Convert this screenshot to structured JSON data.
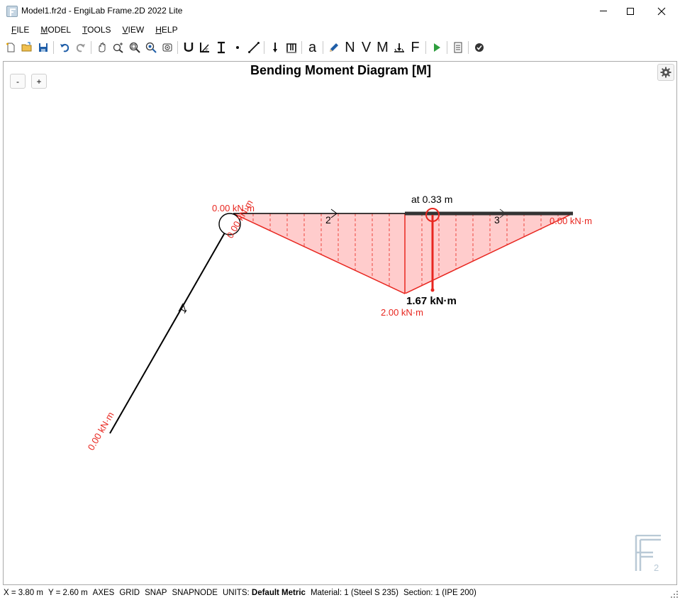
{
  "window": {
    "title": "Model1.fr2d - EngiLab Frame.2D 2022 Lite",
    "controls": [
      "minimize",
      "maximize",
      "close"
    ]
  },
  "menu": [
    {
      "label": "FILE",
      "mnemonic": "F",
      "rest": "ILE"
    },
    {
      "label": "MODEL",
      "mnemonic": "M",
      "rest": "ODEL"
    },
    {
      "label": "TOOLS",
      "mnemonic": "T",
      "rest": "OOLS"
    },
    {
      "label": "VIEW",
      "mnemonic": "V",
      "rest": "IEW"
    },
    {
      "label": "HELP",
      "mnemonic": "H",
      "rest": "ELP"
    }
  ],
  "toolbar": {
    "icons": [
      "new-file-icon",
      "open-file-icon",
      "save-icon",
      "undo-icon",
      "redo-icon",
      "pan-icon",
      "zoom-in-icon",
      "zoom-extents-icon",
      "zoom-window-icon",
      "zoom-previous-icon",
      "support-icon",
      "section-icon",
      "profile-icon",
      "node-icon",
      "element-icon",
      "point-load-icon",
      "distributed-load-icon",
      "text-icon",
      "pencil-icon",
      "axial-force-icon",
      "shear-force-icon",
      "bending-moment-icon",
      "reactions-icon",
      "deformed-shape-icon",
      "run-analysis-icon",
      "report-icon",
      "check-icon"
    ],
    "letters": {
      "text": "a",
      "axial": "N",
      "shear": "V",
      "moment": "M",
      "deformed": "F"
    },
    "accent_run": "#2e9e3e",
    "accent_pencil": "#1f5ea8"
  },
  "canvas": {
    "zoom_out_label": "-",
    "zoom_in_label": "+",
    "title": "Bending Moment Diagram [M]",
    "settings_icon": "gear-icon"
  },
  "diagram": {
    "member_labels": [
      "1",
      "2",
      "3"
    ],
    "moment_labels": {
      "node_2_start": "0.00 kN·m",
      "node_1_end": "0.00 kN·m",
      "node_2_end": "0.00 kN·m",
      "member_1_start": "0.00 kN·m",
      "peak": "2.00 kN·m",
      "selected_value": "1.67 kN·m",
      "selected_location": "at 0.33 m"
    },
    "colors": {
      "moment_line": "#e8261f",
      "moment_fill": "#ffcccc",
      "member": "#000000",
      "selected_member": "#333333",
      "logo": "#b9c9d6"
    }
  },
  "statusbar": {
    "x": "X = 3.80 m",
    "y": "Y = 2.60 m",
    "axes": "AXES",
    "grid": "GRID",
    "snap": "SNAP",
    "snapnode": "SNAPNODE",
    "units_label": "UNITS:",
    "units_value": "Default Metric",
    "material": "Material: 1 (Steel S 235)",
    "section": "Section: 1 (IPE 200)"
  }
}
